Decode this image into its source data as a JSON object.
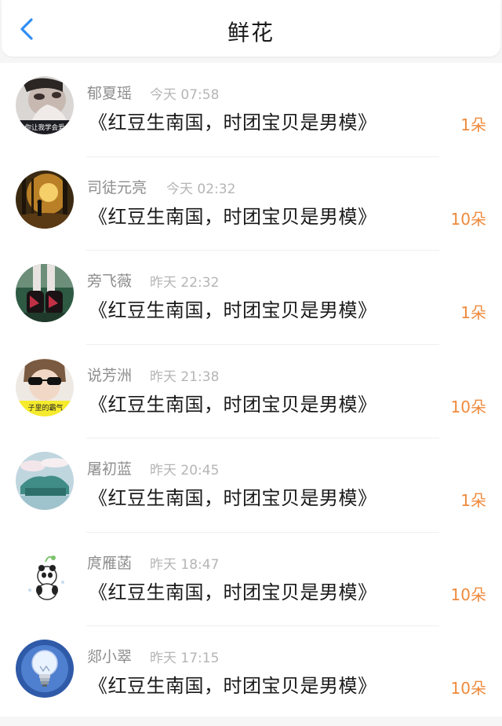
{
  "header": {
    "title": "鲜花",
    "back_icon": "chevron-left-icon",
    "accent_color": "#2f8ef5"
  },
  "colors": {
    "count_color": "#ef8a3c",
    "name_color": "#8e8e8e",
    "time_color": "#b5b5b5"
  },
  "items": [
    {
      "name": "郁夏瑶",
      "time": "今天 07:58",
      "message": "《红豆生南国，时团宝贝是男模》",
      "count": "1朵",
      "avatar_text": "你让我学会爱"
    },
    {
      "name": "司徒元亮",
      "time": "今天 02:32",
      "message": "《红豆生南国，时团宝贝是男模》",
      "count": "10朵"
    },
    {
      "name": "旁飞薇",
      "time": "昨天 22:32",
      "message": "《红豆生南国，时团宝贝是男模》",
      "count": "1朵"
    },
    {
      "name": "说芳洲",
      "time": "昨天 21:38",
      "message": "《红豆生南国，时团宝贝是男模》",
      "count": "10朵",
      "avatar_text": "子里的霸气"
    },
    {
      "name": "屠初蓝",
      "time": "昨天 20:45",
      "message": "《红豆生南国，时团宝贝是男模》",
      "count": "1朵"
    },
    {
      "name": "庹雁菡",
      "time": "昨天 18:47",
      "message": "《红豆生南国，时团宝贝是男模》",
      "count": "10朵"
    },
    {
      "name": "郯小翠",
      "time": "昨天 17:15",
      "message": "《红豆生南国，时团宝贝是男模》",
      "count": "10朵"
    }
  ]
}
